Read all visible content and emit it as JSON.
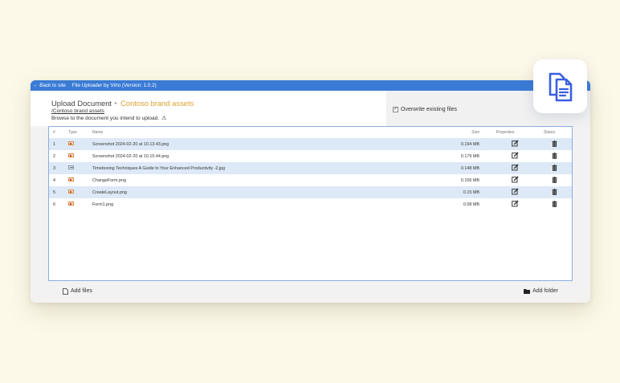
{
  "topbar": {
    "back_label": "Back to site",
    "app_title": "File Uploader by Virto (Version: 1.0.2)"
  },
  "header": {
    "title": "Upload Document",
    "library": "Contoso brand assets",
    "path": "/Contoso brand assets",
    "hint": "Browse to the document you intend to upload."
  },
  "options": {
    "overwrite_label": "Overwrite existing files",
    "overwrite_checked": true
  },
  "table": {
    "headers": {
      "num": "#",
      "type": "Type",
      "name": "Name",
      "size": "Size",
      "properties": "Properties",
      "status": "Status"
    },
    "rows": [
      {
        "num": "1",
        "type": "image",
        "name": "Screenshot 2024-02-20 at 10.13.43.png",
        "size": "0.194 MB"
      },
      {
        "num": "2",
        "type": "image",
        "name": "Screenshot 2024-02-20 at 10.15.44.png",
        "size": "0.179 MB"
      },
      {
        "num": "3",
        "type": "document",
        "name": "Timeboxing Techniques A Guide to Your Enhanced Productivity -2.jpg",
        "size": "0.148 MB"
      },
      {
        "num": "4",
        "type": "image",
        "name": "ChangeForm.png",
        "size": "0.156 MB"
      },
      {
        "num": "5",
        "type": "image",
        "name": "CreateLayout.png",
        "size": "0.15 MB"
      },
      {
        "num": "6",
        "type": "image",
        "name": "Form1.png",
        "size": "0.08 MB"
      }
    ]
  },
  "footer": {
    "add_files": "Add files",
    "add_folder": "Add folder"
  },
  "colors": {
    "page_bg": "#fdf9e9",
    "topbar": "#3a7bd5",
    "accent": "#e0a030",
    "row_alt": "#dde9f7",
    "table_border": "#8aaee0"
  },
  "icons": {
    "back": "arrow-left-icon",
    "warning": "warning-icon",
    "add_files": "file-icon",
    "add_folder": "folder-icon",
    "properties": "edit-icon",
    "status": "trash-icon",
    "app": "copy-documents-icon"
  }
}
